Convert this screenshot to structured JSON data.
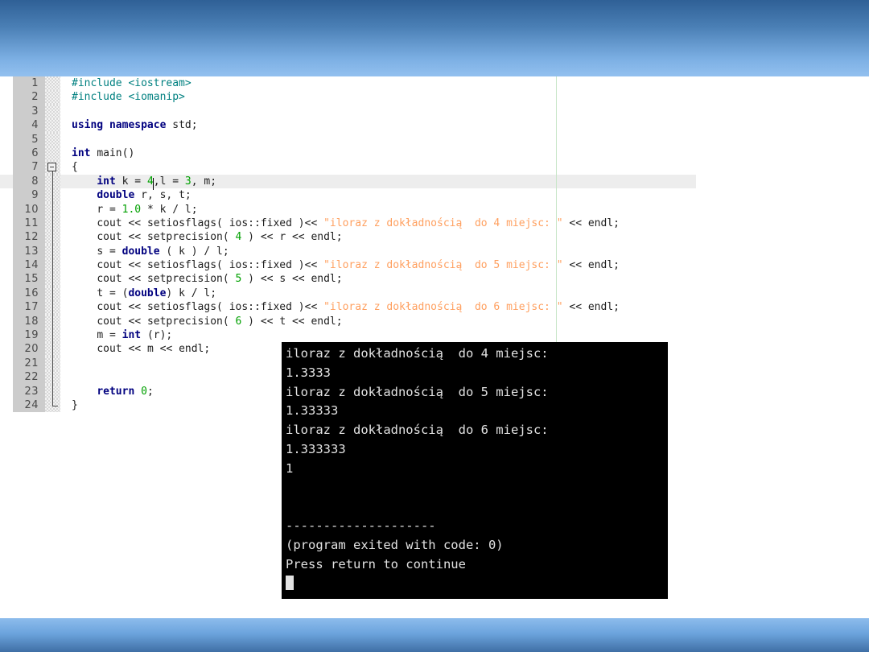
{
  "slide": {
    "header_band_color": "#2f6096",
    "footer_band_color": "#6ca4dd",
    "background_color": "#ffffff"
  },
  "editor": {
    "name": "code-editor",
    "language": "cpp",
    "current_line": 8,
    "guide_column_marker": true,
    "gutter_color": "#cccccc",
    "current_line_highlight": "#ededed",
    "lines": [
      {
        "n": "1",
        "text": "#include <iostream>"
      },
      {
        "n": "2",
        "text": "#include <iomanip>"
      },
      {
        "n": "3",
        "text": ""
      },
      {
        "n": "4",
        "text": "using namespace std;"
      },
      {
        "n": "5",
        "text": ""
      },
      {
        "n": "6",
        "text": "int main()"
      },
      {
        "n": "7",
        "text": "{"
      },
      {
        "n": "8",
        "text": "    int k = 4,l = 3, m;"
      },
      {
        "n": "9",
        "text": "    double r, s, t;"
      },
      {
        "n": "10",
        "text": "    r = 1.0 * k / l;"
      },
      {
        "n": "11",
        "text": "    cout << setiosflags( ios::fixed )<< \"iloraz z dokładnością  do 4 miejsc: \" << endl;"
      },
      {
        "n": "12",
        "text": "    cout << setprecision( 4 ) << r << endl;"
      },
      {
        "n": "13",
        "text": "    s = double ( k ) / l;"
      },
      {
        "n": "14",
        "text": "    cout << setiosflags( ios::fixed )<< \"iloraz z dokładnością  do 5 miejsc: \" << endl;"
      },
      {
        "n": "15",
        "text": "    cout << setprecision( 5 ) << s << endl;"
      },
      {
        "n": "16",
        "text": "    t = (double) k / l;"
      },
      {
        "n": "17",
        "text": "    cout << setiosflags( ios::fixed )<< \"iloraz z dokładnością  do 6 miejsc: \" << endl;"
      },
      {
        "n": "18",
        "text": "    cout << setprecision( 6 ) << t << endl;"
      },
      {
        "n": "19",
        "text": "    m = int (r);"
      },
      {
        "n": "20",
        "text": "    cout << m << endl;"
      },
      {
        "n": "21",
        "text": ""
      },
      {
        "n": "22",
        "text": ""
      },
      {
        "n": "23",
        "text": "    return 0;"
      },
      {
        "n": "24",
        "text": "}"
      }
    ]
  },
  "console": {
    "name": "program-output-console",
    "background_color": "#000000",
    "text_color": "#e2e2e2",
    "lines": [
      "iloraz z dokładnością  do 4 miejsc:",
      "1.3333",
      "iloraz z dokładnością  do 5 miejsc:",
      "1.33333",
      "iloraz z dokładnością  do 6 miejsc:",
      "1.333333",
      "1",
      "",
      "",
      "--------------------",
      "(program exited with code: 0)",
      "Press return to continue"
    ],
    "cursor_visible": true
  }
}
